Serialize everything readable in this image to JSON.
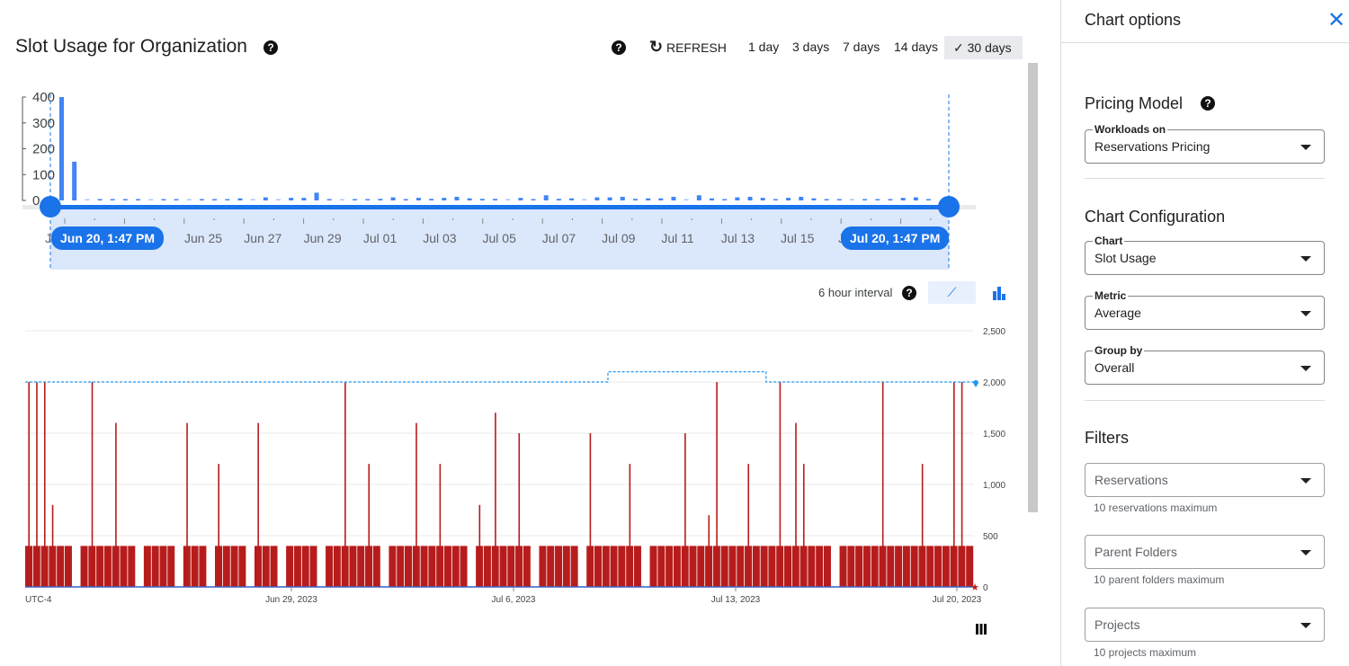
{
  "header": {
    "title": "Slot Usage for Organization",
    "refresh_label": "REFRESH",
    "ranges": [
      "1 day",
      "3 days",
      "7 days",
      "14 days",
      "30 days"
    ],
    "selected_range": "30 days"
  },
  "navigator": {
    "y_ticks": [
      "400",
      "300",
      "200",
      "100",
      "0"
    ],
    "x_labels": [
      "J",
      "Jun 25",
      "Jun 27",
      "Jun 29",
      "Jul 01",
      "Jul 03",
      "Jul 05",
      "Jul 07",
      "Jul 09",
      "Jul 11",
      "Jul 13",
      "Jul 15",
      "Ju"
    ],
    "start_label": "Jun 20, 1:47 PM",
    "end_label": "Jul 20, 1:47 PM",
    "values": [
      400,
      150,
      0,
      2,
      3,
      2,
      4,
      0,
      3,
      2,
      0,
      3,
      3,
      4,
      8,
      0,
      12,
      0,
      10,
      10,
      30,
      4,
      0,
      3,
      3,
      6,
      12,
      4,
      10,
      6,
      10,
      14,
      8,
      6,
      6,
      0,
      10,
      4,
      20,
      6,
      8,
      0,
      12,
      12,
      14,
      6,
      8,
      8,
      14,
      0,
      20,
      8,
      2,
      12,
      14,
      10,
      4,
      10,
      14,
      8,
      4,
      4,
      0,
      3,
      5,
      4,
      10,
      12,
      4
    ],
    "accent": "#1a73e8"
  },
  "chart": {
    "interval_label": "6 hour interval"
  },
  "chart_data": {
    "type": "bar",
    "ylim": [
      0,
      2500
    ],
    "y_ticks": [
      "2,500",
      "2,000",
      "1,500",
      "1,000",
      "500",
      "0"
    ],
    "x_labels": [
      "UTC-4",
      "Jun 29, 2023",
      "Jul 6, 2023",
      "Jul 13, 2023",
      "Jul 20, 2023"
    ],
    "interval": "6 hour",
    "series_color": "#b71c1c",
    "capacity_color": "#2196f3",
    "values": [
      2000,
      2000,
      2000,
      800,
      400,
      400,
      0,
      400,
      2000,
      400,
      400,
      1600,
      400,
      400,
      0,
      400,
      400,
      400,
      400,
      0,
      1600,
      400,
      400,
      0,
      1200,
      400,
      400,
      400,
      0,
      1600,
      400,
      400,
      0,
      400,
      400,
      400,
      400,
      0,
      400,
      400,
      2000,
      400,
      400,
      1200,
      400,
      0,
      400,
      400,
      400,
      1600,
      400,
      400,
      1200,
      400,
      400,
      400,
      0,
      800,
      400,
      1700,
      400,
      400,
      1500,
      400,
      0,
      400,
      400,
      400,
      400,
      400,
      0,
      1500,
      400,
      400,
      400,
      400,
      1200,
      400,
      0,
      400,
      400,
      400,
      400,
      1500,
      400,
      400,
      700,
      2000,
      400,
      400,
      400,
      1200,
      400,
      400,
      400,
      2000,
      400,
      1600,
      1200,
      400,
      400,
      400,
      0,
      400,
      400,
      400,
      400,
      400,
      2000,
      400,
      400,
      400,
      400,
      1200,
      400,
      400,
      400,
      2000,
      2000,
      400
    ],
    "capacity": [
      {
        "from": "Jun 20, 2023",
        "to": "Jul 9, 2023",
        "value": 2000
      },
      {
        "from": "Jul 9, 2023",
        "to": "Jul 14, 2023",
        "value": 2100
      },
      {
        "from": "Jul 14, 2023",
        "to": "Jul 20, 2023",
        "value": 2000
      }
    ]
  },
  "panel": {
    "title": "Chart options",
    "pricing_title": "Pricing Model",
    "workloads_label": "Workloads on",
    "workloads_value": "Reservations Pricing",
    "config_title": "Chart Configuration",
    "chart_label": "Chart",
    "chart_value": "Slot Usage",
    "metric_label": "Metric",
    "metric_value": "Average",
    "group_label": "Group by",
    "group_value": "Overall",
    "filters_title": "Filters",
    "reservations_ph": "Reservations",
    "reservations_hint": "10 reservations maximum",
    "folders_ph": "Parent Folders",
    "folders_hint": "10 parent folders maximum",
    "projects_ph": "Projects",
    "projects_hint": "10 projects maximum"
  }
}
